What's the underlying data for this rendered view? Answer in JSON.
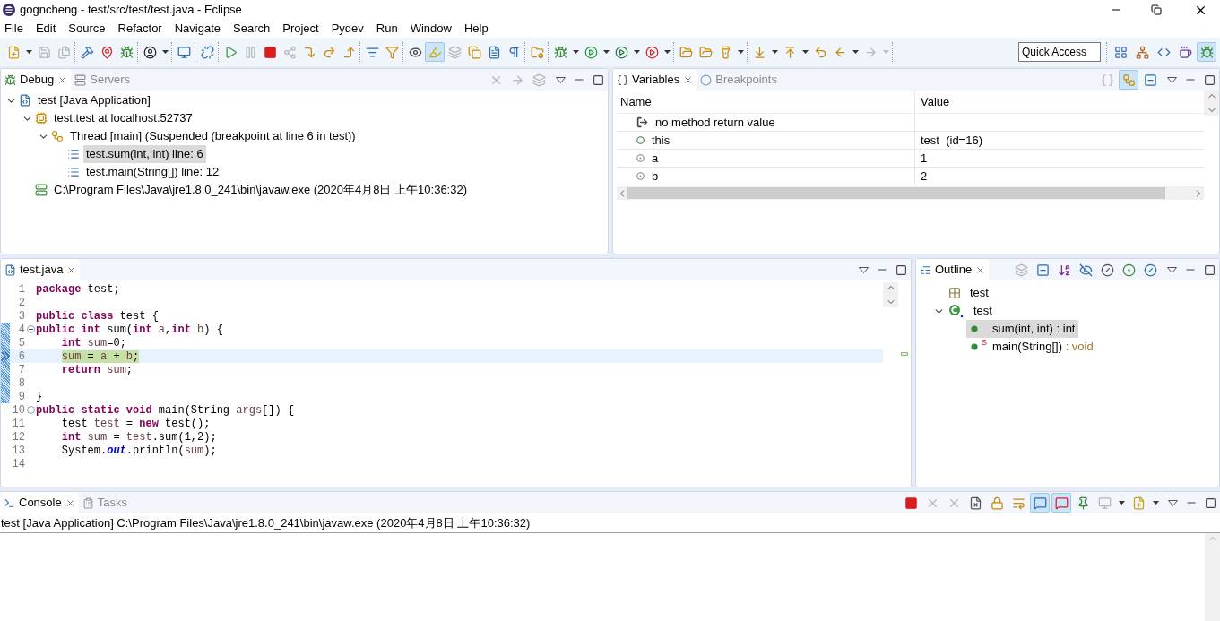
{
  "window": {
    "title": "gogncheng - test/src/test/test.java - Eclipse"
  },
  "menu": [
    "File",
    "Edit",
    "Source",
    "Refactor",
    "Navigate",
    "Search",
    "Project",
    "Pydev",
    "Run",
    "Window",
    "Help"
  ],
  "toolbar": {
    "groups": [
      [
        {
          "kind": "new",
          "selected": false,
          "disabled": false
        },
        {
          "kind": "caret",
          "selected": false,
          "disabled": false
        },
        {
          "kind": "save",
          "selected": false,
          "disabled": true
        },
        {
          "kind": "saveall",
          "selected": false,
          "disabled": true
        }
      ],
      [
        {
          "kind": "build",
          "selected": false,
          "disabled": false
        },
        {
          "kind": "pin",
          "selected": false,
          "disabled": false
        },
        {
          "kind": "bug",
          "selected": false,
          "disabled": false
        }
      ],
      [
        {
          "kind": "person",
          "selected": false,
          "disabled": false
        },
        {
          "kind": "caret",
          "selected": false,
          "disabled": false
        }
      ],
      [
        {
          "kind": "monitor",
          "selected": false,
          "disabled": false
        }
      ],
      [
        {
          "kind": "unlink",
          "selected": false,
          "disabled": false
        }
      ],
      [
        {
          "kind": "resume",
          "selected": false,
          "disabled": false
        },
        {
          "kind": "suspend",
          "selected": false,
          "disabled": true
        },
        {
          "kind": "terminate",
          "selected": false,
          "disabled": false
        },
        {
          "kind": "disconnect",
          "selected": false,
          "disabled": true
        },
        {
          "kind": "stepinto",
          "selected": false,
          "disabled": false
        },
        {
          "kind": "stepover",
          "selected": false,
          "disabled": false
        },
        {
          "kind": "stepreturn",
          "selected": false,
          "disabled": false
        }
      ],
      [
        {
          "kind": "filters",
          "selected": false,
          "disabled": false
        },
        {
          "kind": "skip",
          "selected": false,
          "disabled": false
        }
      ],
      [
        {
          "kind": "watch",
          "selected": false,
          "disabled": false
        },
        {
          "kind": "marker",
          "selected": true,
          "disabled": false
        },
        {
          "kind": "threads",
          "selected": false,
          "disabled": true
        },
        {
          "kind": "copy",
          "selected": false,
          "disabled": false
        },
        {
          "kind": "doc",
          "selected": false,
          "disabled": false
        },
        {
          "kind": "pilcrow",
          "selected": false,
          "disabled": false
        }
      ],
      [
        {
          "kind": "project",
          "selected": false,
          "disabled": false
        }
      ],
      [
        {
          "kind": "debug",
          "selected": false,
          "disabled": false
        },
        {
          "kind": "caret",
          "selected": false,
          "disabled": false
        },
        {
          "kind": "run",
          "selected": false,
          "disabled": false
        },
        {
          "kind": "caret",
          "selected": false,
          "disabled": false
        },
        {
          "kind": "coverage",
          "selected": false,
          "disabled": false
        },
        {
          "kind": "caret",
          "selected": false,
          "disabled": false
        },
        {
          "kind": "tools",
          "selected": false,
          "disabled": false
        },
        {
          "kind": "caret",
          "selected": false,
          "disabled": false
        }
      ],
      [
        {
          "kind": "opentype",
          "selected": false,
          "disabled": false
        },
        {
          "kind": "opentask",
          "selected": false,
          "disabled": false
        },
        {
          "kind": "search",
          "selected": false,
          "disabled": false
        },
        {
          "kind": "caret",
          "selected": false,
          "disabled": false
        }
      ],
      [
        {
          "kind": "next",
          "selected": false,
          "disabled": false
        },
        {
          "kind": "caret",
          "selected": false,
          "disabled": false
        },
        {
          "kind": "prev",
          "selected": false,
          "disabled": false
        },
        {
          "kind": "caret",
          "selected": false,
          "disabled": false
        },
        {
          "kind": "lastedit",
          "selected": false,
          "disabled": false
        },
        {
          "kind": "back",
          "selected": false,
          "disabled": false
        },
        {
          "kind": "caret",
          "selected": false,
          "disabled": false
        },
        {
          "kind": "forward",
          "selected": false,
          "disabled": true
        },
        {
          "kind": "caret",
          "selected": false,
          "disabled": true
        }
      ]
    ],
    "quick_access": {
      "placeholder": "Quick Access"
    },
    "perspectives": [
      {
        "kind": "perspective",
        "selected": false,
        "disabled": false
      },
      {
        "kind": "javaee",
        "selected": false,
        "disabled": false
      },
      {
        "kind": "python",
        "selected": false,
        "disabled": false
      },
      {
        "kind": "java",
        "selected": false,
        "disabled": false
      },
      {
        "kind": "debug",
        "selected": true,
        "disabled": false
      }
    ]
  },
  "debug_view": {
    "tabs": [
      {
        "kind": "debug",
        "label": "Debug",
        "selected": true
      },
      {
        "kind": "servers",
        "label": "Servers",
        "selected": false
      }
    ],
    "buttons": [
      {
        "kind": "removeall",
        "selected": false,
        "disabled": true
      },
      {
        "kind": "forwardview",
        "selected": false,
        "disabled": true
      },
      {
        "kind": "threads",
        "selected": false,
        "disabled": true
      }
    ],
    "tree": [
      {
        "kind": "launch",
        "label": "test [Java Application]",
        "selected": false,
        "expanded": true,
        "children": [
          {
            "kind": "target",
            "label": "test.test at localhost:52737",
            "selected": false,
            "expanded": true,
            "children": [
              {
                "kind": "thread",
                "label": "Thread [main] (Suspended (breakpoint at line 6 in test))",
                "selected": false,
                "expanded": true,
                "children": [
                  {
                    "kind": "frame",
                    "label": "test.sum(int, int) line: 6",
                    "selected": true
                  },
                  {
                    "kind": "frame",
                    "label": "test.main(String[]) line: 12",
                    "selected": false
                  }
                ]
              }
            ]
          },
          {
            "kind": "process",
            "label": "C:\\Program Files\\Java\\jre1.8.0_241\\bin\\javaw.exe (2020年4月8日 上午10:36:32)",
            "selected": false
          }
        ]
      }
    ]
  },
  "variables_view": {
    "tabs": [
      {
        "kind": "variables",
        "label": "Variables",
        "selected": true
      },
      {
        "kind": "breakpoints",
        "label": "Breakpoints",
        "selected": false
      }
    ],
    "buttons": [
      {
        "kind": "typenames",
        "selected": false,
        "disabled": true
      },
      {
        "kind": "logical",
        "selected": true,
        "disabled": false
      },
      {
        "kind": "collapse",
        "selected": false,
        "disabled": false
      }
    ],
    "columns": [
      "Name",
      "Value"
    ],
    "rows": [
      {
        "kind": "return",
        "name": "no method return value"
      },
      {
        "kind": "field",
        "name": "this",
        "value": "test  (id=16)"
      },
      {
        "kind": "local",
        "name": "a",
        "value": "1"
      },
      {
        "kind": "local",
        "name": "b",
        "value": "2"
      }
    ]
  },
  "editor": {
    "tabs": [
      {
        "kind": "java",
        "label": "test.java",
        "selected": true
      }
    ],
    "lines": [
      {
        "number": "1",
        "current": false,
        "range": false,
        "tokens": [
          {
            "kind": "keyword",
            "text": "package"
          },
          {
            "kind": "plain",
            "text": " test;"
          }
        ]
      },
      {
        "number": "2",
        "current": false,
        "range": false
      },
      {
        "number": "3",
        "current": false,
        "range": false,
        "tokens": [
          {
            "kind": "keyword",
            "text": "public"
          },
          {
            "kind": "keyword",
            "text": " class"
          },
          {
            "kind": "plain",
            "text": " test {"
          }
        ]
      },
      {
        "number": "4",
        "current": false,
        "range": true,
        "collapsed": false,
        "tokens": [
          {
            "kind": "keyword",
            "text": "public"
          },
          {
            "kind": "keyword",
            "text": " int"
          },
          {
            "kind": "plain",
            "text": " sum("
          },
          {
            "kind": "keyword",
            "text": "int"
          },
          {
            "kind": "variable",
            "text": " a"
          },
          {
            "kind": "plain",
            "text": ","
          },
          {
            "kind": "keyword",
            "text": "int"
          },
          {
            "kind": "variable",
            "text": " b"
          },
          {
            "kind": "plain",
            "text": ") {"
          }
        ]
      },
      {
        "number": "5",
        "current": false,
        "range": true,
        "tokens": [
          {
            "kind": "keyword",
            "text": "    int"
          },
          {
            "kind": "variable",
            "text": " sum"
          },
          {
            "kind": "plain",
            "text": "=0;"
          }
        ]
      },
      {
        "number": "6",
        "current": true,
        "range": true,
        "tokens": [
          {
            "kind": "variable",
            "text": "    sum"
          },
          {
            "kind": "plain",
            "text": " = "
          },
          {
            "kind": "variable",
            "text": "a"
          },
          {
            "kind": "plain",
            "text": " + "
          },
          {
            "kind": "variable",
            "text": "b"
          },
          {
            "kind": "plain",
            "text": ";"
          }
        ]
      },
      {
        "number": "7",
        "current": false,
        "range": true,
        "tokens": [
          {
            "kind": "keyword",
            "text": "    return"
          },
          {
            "kind": "variable",
            "text": " sum"
          },
          {
            "kind": "plain",
            "text": ";"
          }
        ]
      },
      {
        "number": "8",
        "current": false,
        "range": true
      },
      {
        "number": "9",
        "current": false,
        "range": true,
        "tokens": [
          {
            "kind": "plain",
            "text": "}"
          }
        ]
      },
      {
        "number": "10",
        "current": false,
        "range": false,
        "collapsed": false,
        "tokens": [
          {
            "kind": "keyword",
            "text": "public"
          },
          {
            "kind": "keyword",
            "text": " static"
          },
          {
            "kind": "keyword",
            "text": " void"
          },
          {
            "kind": "plain",
            "text": " main(String "
          },
          {
            "kind": "variable",
            "text": "args"
          },
          {
            "kind": "plain",
            "text": "[]) {"
          }
        ]
      },
      {
        "number": "11",
        "current": false,
        "range": false,
        "tokens": [
          {
            "kind": "plain",
            "text": "    test "
          },
          {
            "kind": "variable",
            "text": "test"
          },
          {
            "kind": "plain",
            "text": " = "
          },
          {
            "kind": "keyword",
            "text": "new"
          },
          {
            "kind": "plain",
            "text": " test();"
          }
        ]
      },
      {
        "number": "12",
        "current": false,
        "range": false,
        "tokens": [
          {
            "kind": "keyword",
            "text": "    int"
          },
          {
            "kind": "variable",
            "text": " sum"
          },
          {
            "kind": "plain",
            "text": " = "
          },
          {
            "kind": "variable",
            "text": "test"
          },
          {
            "kind": "plain",
            "text": ".sum(1,2);"
          }
        ]
      },
      {
        "number": "13",
        "current": false,
        "range": false,
        "tokens": [
          {
            "kind": "plain",
            "text": "    System."
          },
          {
            "kind": "static",
            "text": "out"
          },
          {
            "kind": "plain",
            "text": ".println("
          },
          {
            "kind": "variable",
            "text": "sum"
          },
          {
            "kind": "plain",
            "text": ");"
          }
        ]
      },
      {
        "number": "14",
        "current": false,
        "range": false
      }
    ]
  },
  "outline_view": {
    "tabs": [
      {
        "kind": "outline",
        "label": "Outline",
        "selected": true
      }
    ],
    "buttons": [
      {
        "kind": "threads",
        "selected": false,
        "disabled": true
      },
      {
        "kind": "collapse",
        "selected": false,
        "disabled": false
      },
      {
        "kind": "sortaz",
        "selected": false,
        "disabled": false
      },
      {
        "kind": "hidefields",
        "selected": false,
        "disabled": false
      },
      {
        "kind": "hidestatic",
        "selected": false,
        "disabled": false
      },
      {
        "kind": "dot",
        "selected": false,
        "disabled": false
      },
      {
        "kind": "hidelocal",
        "selected": false,
        "disabled": false
      }
    ],
    "tree": [
      {
        "kind": "package",
        "label": "test",
        "selected": false
      },
      {
        "kind": "class",
        "label": "test",
        "selected": false,
        "expanded": true,
        "children": [
          {
            "kind": "method",
            "label": "sum(int, int)",
            "return_type": " : int",
            "selected": true
          },
          {
            "kind": "method",
            "label": "main(String[])",
            "return_type": " : void",
            "static_marker": "S",
            "selected": false
          }
        ]
      }
    ]
  },
  "console_view": {
    "tabs": [
      {
        "kind": "console",
        "label": "Console",
        "selected": true
      },
      {
        "kind": "tasks",
        "label": "Tasks",
        "selected": false
      }
    ],
    "buttons": [
      {
        "kind": "terminate",
        "selected": false,
        "disabled": false
      },
      {
        "kind": "removelaunch",
        "selected": false,
        "disabled": true
      },
      {
        "kind": "removeall",
        "selected": false,
        "disabled": true
      },
      {
        "kind": "clear",
        "selected": false,
        "disabled": false
      },
      {
        "kind": "lock",
        "selected": false,
        "disabled": false
      },
      {
        "kind": "wordwrap",
        "selected": false,
        "disabled": false
      },
      {
        "kind": "showout",
        "selected": true,
        "disabled": false
      },
      {
        "kind": "showerr",
        "selected": true,
        "disabled": false
      },
      {
        "kind": "pinconsole",
        "selected": false,
        "disabled": false
      },
      {
        "kind": "display",
        "selected": false,
        "disabled": true
      },
      {
        "kind": "caret",
        "selected": false,
        "disabled": false
      },
      {
        "kind": "newconsole",
        "selected": false,
        "disabled": false
      },
      {
        "kind": "caret",
        "selected": false,
        "disabled": false
      }
    ],
    "header": "test [Java Application] C:\\Program Files\\Java\\jre1.8.0_241\\bin\\javaw.exe (2020年4月8日 上午10:36:32)"
  }
}
